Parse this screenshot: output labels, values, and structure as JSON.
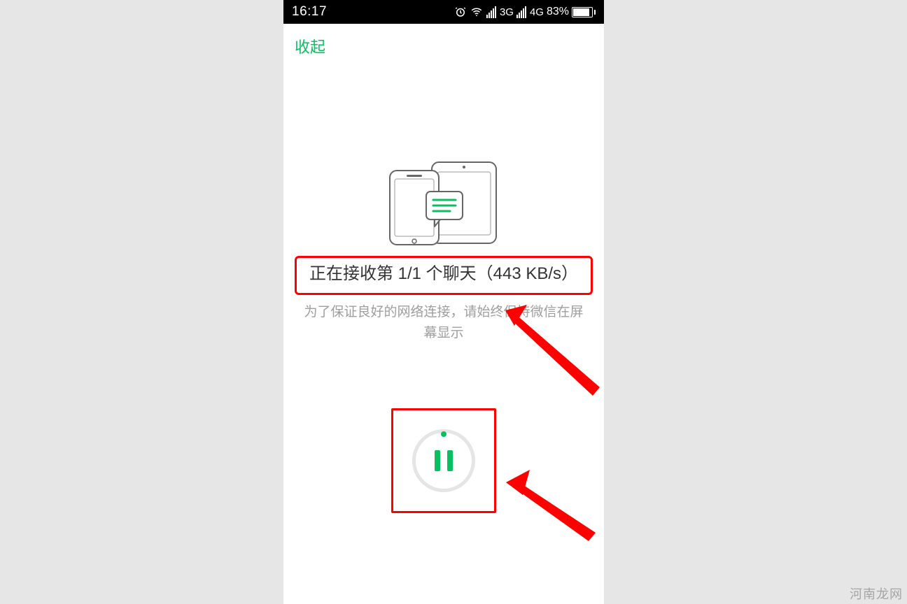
{
  "status_bar": {
    "time": "16:17",
    "signal3g_label": "3G",
    "signal4g_label": "4G",
    "battery_percent": "83%"
  },
  "nav": {
    "collapse_label": "收起"
  },
  "transfer": {
    "status_text": "正在接收第 1/1 个聊天（443 KB/s）",
    "help_text": "为了保证良好的网络连接，请始终保持微信在屏幕显示"
  },
  "watermark": "河南龙网"
}
